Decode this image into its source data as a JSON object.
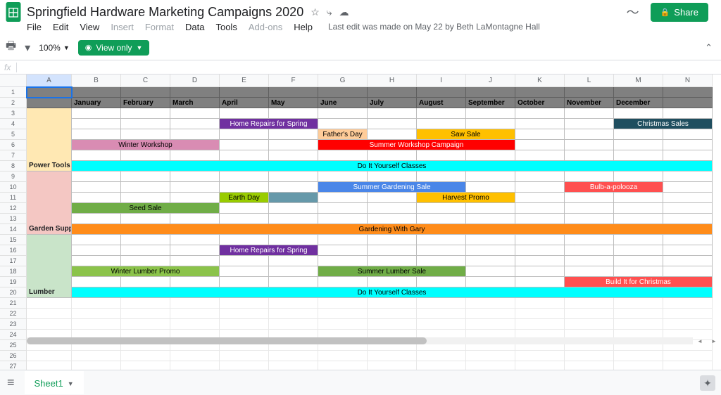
{
  "doc": {
    "title": "Springfield Hardware Marketing Campaigns 2020"
  },
  "menu": {
    "file": "File",
    "edit": "Edit",
    "view": "View",
    "insert": "Insert",
    "format": "Format",
    "data": "Data",
    "tools": "Tools",
    "addons": "Add-ons",
    "help": "Help",
    "last_edit": "Last edit was made on May 22 by Beth LaMontagne Hall"
  },
  "toolbar": {
    "zoom": "100%",
    "view_only": "View only"
  },
  "share": {
    "label": "Share"
  },
  "fx": "fx",
  "columns": [
    "",
    "A",
    "B",
    "C",
    "D",
    "E",
    "F",
    "G",
    "H",
    "I",
    "J",
    "K",
    "L",
    "M",
    "N"
  ],
  "months": [
    "January",
    "February",
    "March",
    "April",
    "May",
    "June",
    "July",
    "August",
    "September",
    "October",
    "November",
    "December"
  ],
  "categories": {
    "power_tools": "Power Tools",
    "garden_supply": "Garden Supply",
    "lumber": "Lumber"
  },
  "campaigns": {
    "home_repairs": "Home Repairs for Spring",
    "christmas_sales": "Christmas Sales",
    "fathers_day": "Father's Day",
    "saw_sale": "Saw Sale",
    "winter_workshop": "Winter Workshop",
    "summer_workshop": "Summer Workshop Campaign",
    "diy_classes": "Do It Yourself Classes",
    "summer_gardening": "Summer Gardening Sale",
    "bulb": "Bulb-a-polooza",
    "earth_day": "Earth Day",
    "harvest": "Harvest Promo",
    "seed_sale": "Seed Sale",
    "gardening_gary": "Gardening With Gary",
    "winter_lumber": "Winter Lumber Promo",
    "summer_lumber": "Summer Lumber Sale",
    "build_christmas": "Build It for Christmas"
  },
  "colors": {
    "purple": "#7030a0",
    "teal_dark": "#1f4e5f",
    "peach": "#ffcc99",
    "yellow": "#ffc000",
    "pink": "#d98cb3",
    "red": "#ff0000",
    "cyan": "#00ffff",
    "blue": "#4a86e8",
    "olive": "#99cc00",
    "red2": "#ff5050",
    "steel": "#6699aa",
    "green": "#70ad47",
    "green2": "#8bc34a",
    "orange": "#ff8c1a"
  },
  "sheet_tab": "Sheet1"
}
